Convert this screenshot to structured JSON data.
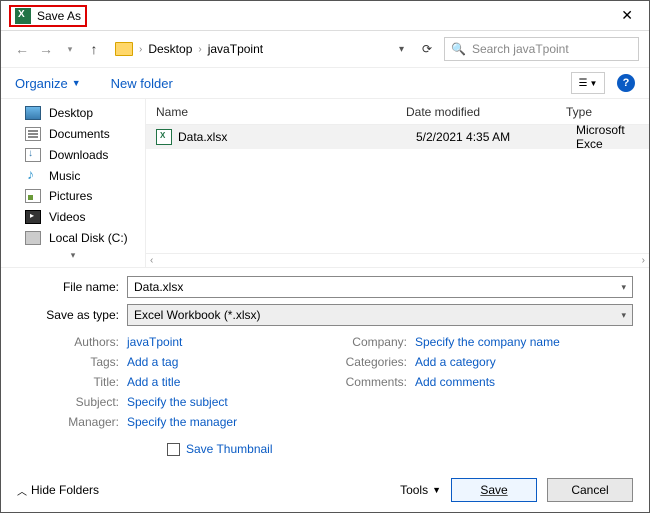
{
  "title": "Save As",
  "breadcrumb": {
    "p1": "Desktop",
    "p2": "javaTpoint"
  },
  "search": {
    "placeholder": "Search javaTpoint"
  },
  "toolbar": {
    "organize": "Organize",
    "newfolder": "New folder"
  },
  "sidebar": {
    "items": [
      {
        "label": "Desktop"
      },
      {
        "label": "Documents"
      },
      {
        "label": "Downloads"
      },
      {
        "label": "Music"
      },
      {
        "label": "Pictures"
      },
      {
        "label": "Videos"
      },
      {
        "label": "Local Disk (C:)"
      }
    ]
  },
  "columns": {
    "name": "Name",
    "date": "Date modified",
    "type": "Type"
  },
  "files": [
    {
      "name": "Data.xlsx",
      "date": "5/2/2021 4:35 AM",
      "type": "Microsoft Exce"
    }
  ],
  "filename": {
    "label": "File name:",
    "value": "Data.xlsx"
  },
  "savetype": {
    "label": "Save as type:",
    "value": "Excel Workbook (*.xlsx)"
  },
  "meta": {
    "authors_l": "Authors:",
    "authors_v": "javaTpoint",
    "tags_l": "Tags:",
    "tags_v": "Add a tag",
    "title_l": "Title:",
    "title_v": "Add a title",
    "subject_l": "Subject:",
    "subject_v": "Specify the subject",
    "manager_l": "Manager:",
    "manager_v": "Specify the manager",
    "company_l": "Company:",
    "company_v": "Specify the company name",
    "categories_l": "Categories:",
    "categories_v": "Add a category",
    "comments_l": "Comments:",
    "comments_v": "Add comments"
  },
  "thumb": "Save Thumbnail",
  "footer": {
    "hide": "Hide Folders",
    "tools": "Tools",
    "save": "Save",
    "cancel": "Cancel"
  }
}
